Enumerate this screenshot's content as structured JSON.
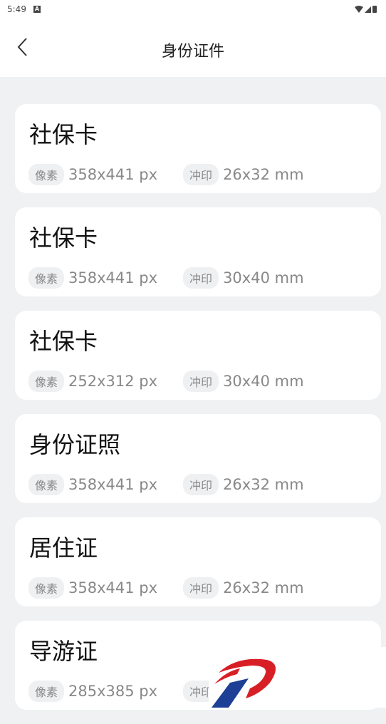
{
  "status_bar": {
    "time": "5:49",
    "notification_badge": "A",
    "icons": [
      "wifi-icon",
      "signal-icon",
      "battery-icon"
    ]
  },
  "header": {
    "title": "身份证件",
    "back_icon": "chevron-left-icon"
  },
  "cards": [
    {
      "title": "社保卡",
      "pixel_label": "像素",
      "pixel_value": "358x441 px",
      "print_label": "冲印",
      "print_value": "26x32 mm"
    },
    {
      "title": "社保卡",
      "pixel_label": "像素",
      "pixel_value": "358x441 px",
      "print_label": "冲印",
      "print_value": "30x40 mm"
    },
    {
      "title": "社保卡",
      "pixel_label": "像素",
      "pixel_value": "252x312 px",
      "print_label": "冲印",
      "print_value": "30x40 mm"
    },
    {
      "title": "身份证照",
      "pixel_label": "像素",
      "pixel_value": "358x441 px",
      "print_label": "冲印",
      "print_value": "26x32 mm"
    },
    {
      "title": "居住证",
      "pixel_label": "像素",
      "pixel_value": "358x441 px",
      "print_label": "冲印",
      "print_value": "26x32 mm"
    },
    {
      "title": "导游证",
      "pixel_label": "像素",
      "pixel_value": "285x385 px",
      "print_label": "冲印",
      "print_value": ""
    }
  ],
  "colors": {
    "background": "#f0f1f3",
    "card": "#ffffff",
    "chip": "#eff0f2",
    "logo_red": "#d81f26",
    "logo_blue": "#1d3f95"
  }
}
